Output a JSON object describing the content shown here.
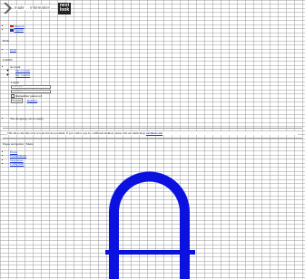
{
  "header": {
    "logo_text": "made ... information",
    "brand_line1": "next",
    "brand_line2": "look"
  },
  "languages": [
    {
      "label": "Deutsch",
      "flag_color": "#cc1a1a"
    },
    {
      "label": "English",
      "flag_color": "#2a3a8a"
    }
  ],
  "currency": {
    "label": "EUR",
    "items": [
      "EUR"
    ]
  },
  "login": {
    "label": "LOGIN",
    "account_title": "Account",
    "links": [
      "My account",
      "My wishlist"
    ],
    "login_title": "Log in",
    "username_placeholder": "Username",
    "password_placeholder": "Password",
    "remember_label": "Remember password",
    "login_button": "Log in",
    "register_link": "Register"
  },
  "cart": {
    "text": "The shopping cart is empty"
  },
  "notice": {
    "text": "This shop currently only accepts invoice payment. If you wish to pay by a different method, please visit our main shop: ",
    "link": "nextlook.com"
  },
  "navigation": {
    "title": "Pages navigation / Menu",
    "items": [
      "Home",
      "Presentations",
      "Magazines",
      "Collections"
    ]
  },
  "colors": {
    "arch": "#0b12e0",
    "link": "#1a3fd0",
    "grid": "#9a9a9a"
  }
}
